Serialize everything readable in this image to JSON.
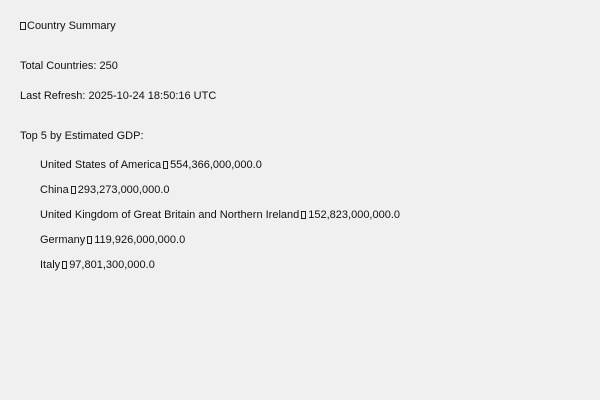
{
  "header": {
    "icon": "box-glyph-icon",
    "title": "Country Summary"
  },
  "summary": {
    "total_label": "Total Countries: 250",
    "refresh_label": "Last Refresh: 2025-10-24 18:50:16 UTC"
  },
  "top_gdp": {
    "heading": "Top 5 by Estimated GDP:",
    "items": [
      {
        "country": "United States of America",
        "value": "554,366,000,000.0"
      },
      {
        "country": "China",
        "value": "293,273,000,000.0"
      },
      {
        "country": "United Kingdom of Great Britain and Northern Ireland",
        "value": "152,823,000,000.0"
      },
      {
        "country": "Germany",
        "value": "119,926,000,000.0"
      },
      {
        "country": "Italy",
        "value": "97,801,300,000.0"
      }
    ]
  }
}
